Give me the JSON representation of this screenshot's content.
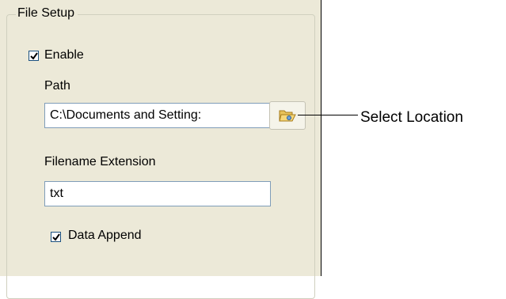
{
  "file_setup": {
    "group_title": "File Setup",
    "enable": {
      "label": "Enable",
      "checked": true
    },
    "path": {
      "label": "Path",
      "value": "C:\\Documents and Setting:"
    },
    "filename_extension": {
      "label": "Filename Extension",
      "value": "txt"
    },
    "data_append": {
      "label": "Data Append",
      "checked": true
    },
    "browse_icon": "folder-open-icon"
  },
  "annotation": {
    "callout_label": "Select Location"
  }
}
